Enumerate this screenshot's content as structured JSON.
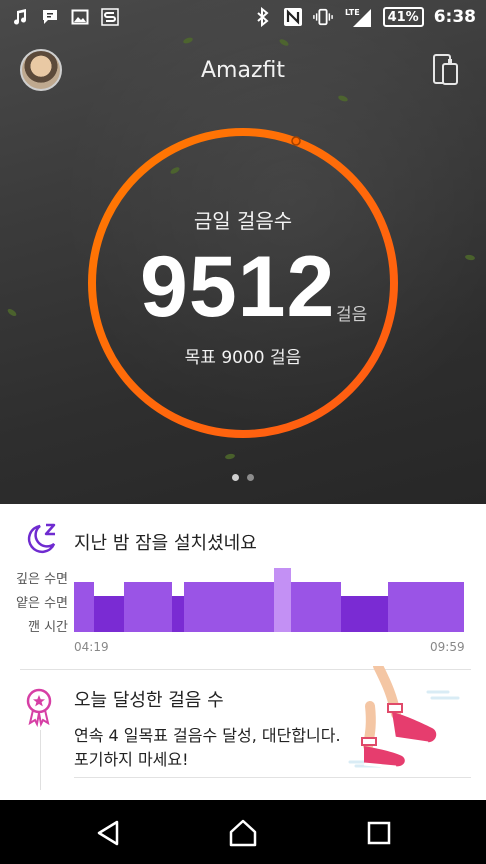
{
  "status_bar": {
    "battery": "41%",
    "time": "6:38",
    "network": "LTE",
    "left_icons": [
      "music-icon",
      "message-icon",
      "image-icon",
      "app-icon"
    ],
    "right_icons": [
      "bluetooth-icon",
      "nfc-icon",
      "vibrate-icon",
      "signal-icon"
    ]
  },
  "header": {
    "title": "Amazfit",
    "avatar_icon": "avatar",
    "device_icon": "device-icon"
  },
  "steps": {
    "label": "금일 걸음수",
    "count": "9512",
    "unit": "걸음",
    "goal_text": "목표 9000 걸음",
    "goal": 9000,
    "progress_fraction": 1.0,
    "ring_color": "#ff6a00"
  },
  "pager": {
    "pages": 2,
    "active": 0
  },
  "sleep": {
    "title": "지난 밤 잠을 설치셨네요",
    "levels": [
      "깊은 수면",
      "얕은 수면",
      "깬 시간"
    ],
    "start_time": "04:19",
    "end_time": "09:59",
    "colors": {
      "deep": "#7a2bd3",
      "light": "#9a54e6",
      "awake": "#c390f4"
    }
  },
  "achievement": {
    "title": "오늘 달성한 걸음 수",
    "description": "연속 4 일목표 걸음수 달성, 대단합니다. 포기하지 마세요!",
    "icon": "award-ribbon-icon",
    "accent": "#d63fa5"
  },
  "nav": {
    "icons": [
      "back-icon",
      "home-icon",
      "recents-icon"
    ]
  }
}
